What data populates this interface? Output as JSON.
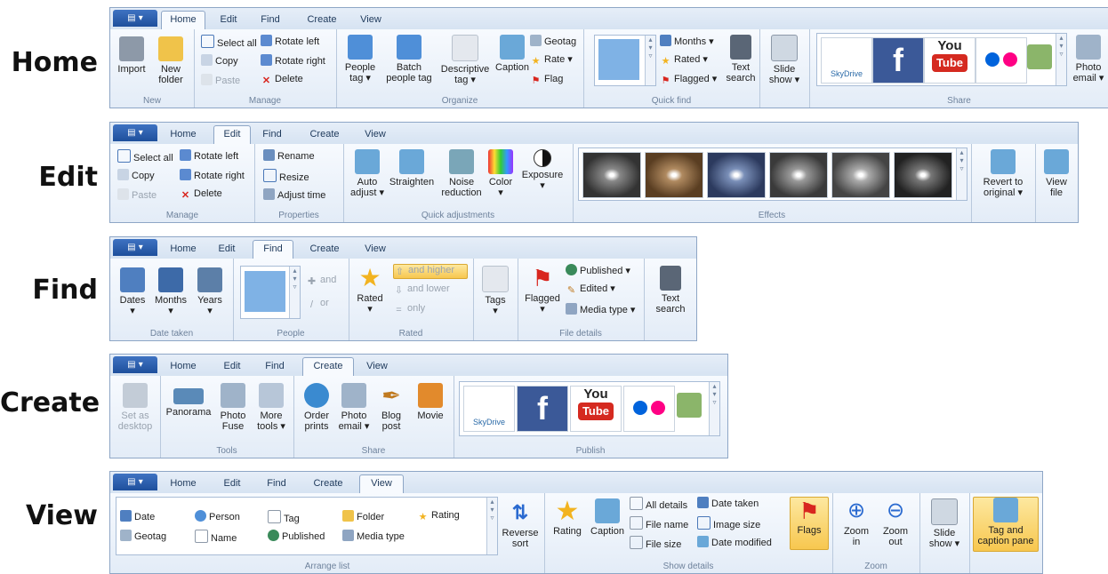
{
  "labels": {
    "home": "Home",
    "edit": "Edit",
    "find": "Find",
    "create": "Create",
    "view": "View"
  },
  "tabs": [
    "Home",
    "Edit",
    "Find",
    "Create",
    "View"
  ],
  "home": {
    "new": {
      "import": "Import",
      "new_folder_1": "New",
      "new_folder_2": "folder",
      "group": "New"
    },
    "manage": {
      "select_all": "Select all",
      "copy": "Copy",
      "paste": "Paste",
      "rotate_left": "Rotate left",
      "rotate_right": "Rotate right",
      "delete": "Delete",
      "group": "Manage"
    },
    "organize": {
      "people_tag_1": "People",
      "people_tag_2": "tag ▾",
      "batch_1": "Batch",
      "batch_2": "people tag",
      "desc_1": "Descriptive",
      "desc_2": "tag ▾",
      "caption": "Caption",
      "geotag": "Geotag",
      "rate": "Rate ▾",
      "flag": "Flag",
      "group": "Organize"
    },
    "quickfind": {
      "months": "Months ▾",
      "rated": "Rated ▾",
      "flagged": "Flagged ▾",
      "text_1": "Text",
      "text_2": "search",
      "group": "Quick find"
    },
    "slide_1": "Slide",
    "slide_2": "show ▾",
    "share": {
      "skydrive": "SkyDrive",
      "facebook": "f",
      "youtube_1": "You",
      "youtube_2": "Tube",
      "photo_1": "Photo",
      "photo_2": "email ▾",
      "group": "Share"
    }
  },
  "edit": {
    "manage": {
      "select_all": "Select all",
      "copy": "Copy",
      "paste": "Paste",
      "rotate_left": "Rotate left",
      "rotate_right": "Rotate right",
      "delete": "Delete",
      "group": "Manage"
    },
    "properties": {
      "rename": "Rename",
      "resize": "Resize",
      "adjust_time": "Adjust time",
      "group": "Properties"
    },
    "quick": {
      "auto_1": "Auto",
      "auto_2": "adjust ▾",
      "straighten": "Straighten",
      "noise_1": "Noise",
      "noise_2": "reduction",
      "color": "Color",
      "color_2": "▾",
      "exposure": "Exposure",
      "exposure_2": "▾",
      "group": "Quick adjustments"
    },
    "effects": {
      "group": "Effects"
    },
    "revert_1": "Revert to",
    "revert_2": "original ▾",
    "view_1": "View",
    "view_2": "file"
  },
  "find": {
    "date": {
      "dates": "Dates",
      "months": "Months",
      "years": "Years",
      "dd": "▾",
      "group": "Date taken"
    },
    "people": {
      "and": "and",
      "or": "or",
      "group": "People"
    },
    "rated": {
      "rated": "Rated",
      "and_higher": "and higher",
      "and_lower": "and lower",
      "only": "only",
      "dd": "▾",
      "group": "Rated"
    },
    "tags": "Tags",
    "file": {
      "flagged": "Flagged",
      "published": "Published ▾",
      "edited": "Edited ▾",
      "media": "Media type ▾",
      "group": "File details"
    },
    "text_1": "Text",
    "text_2": "search"
  },
  "create": {
    "desktop_1": "Set as",
    "desktop_2": "desktop",
    "tools": {
      "panorama": "Panorama",
      "fuse_1": "Photo",
      "fuse_2": "Fuse",
      "more_1": "More",
      "more_2": "tools ▾",
      "group": "Tools"
    },
    "share": {
      "order_1": "Order",
      "order_2": "prints",
      "email_1": "Photo",
      "email_2": "email ▾",
      "blog_1": "Blog",
      "blog_2": "post",
      "movie": "Movie",
      "group": "Share"
    },
    "publish": {
      "skydrive": "SkyDrive",
      "facebook": "f",
      "youtube_1": "You",
      "youtube_2": "Tube",
      "group": "Publish"
    }
  },
  "view": {
    "arrange": {
      "date": "Date",
      "geotag": "Geotag",
      "person": "Person",
      "name": "Name",
      "tag": "Tag",
      "published": "Published",
      "folder": "Folder",
      "media": "Media type",
      "rating": "Rating",
      "reverse_1": "Reverse",
      "reverse_2": "sort",
      "group": "Arrange list"
    },
    "show": {
      "rating": "Rating",
      "caption": "Caption",
      "all_details": "All details",
      "file_name": "File name",
      "file_size": "File size",
      "date_taken": "Date taken",
      "image_size": "Image size",
      "date_modified": "Date modified",
      "flags": "Flags",
      "group": "Show details"
    },
    "zoom": {
      "in_1": "Zoom",
      "in_2": "in",
      "out_1": "Zoom",
      "out_2": "out",
      "group": "Zoom"
    },
    "slide_1": "Slide",
    "slide_2": "show ▾",
    "pane_1": "Tag and",
    "pane_2": "caption pane"
  }
}
